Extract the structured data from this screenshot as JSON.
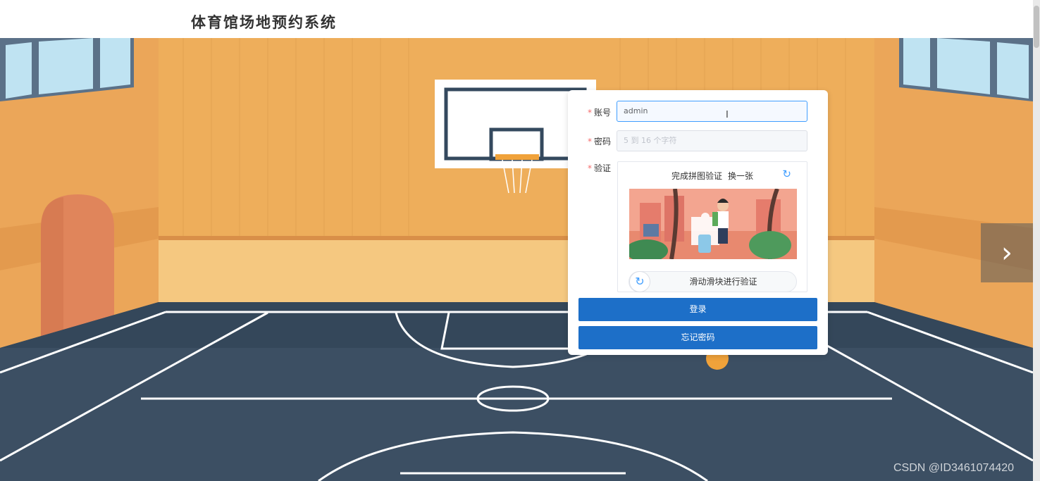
{
  "header": {
    "title": "体育馆场地预约系统"
  },
  "login": {
    "account_label": "账号",
    "account_value": "admin",
    "password_label": "密码",
    "password_placeholder": "5 到 16 个字符",
    "verify_label": "验证",
    "required_mark": "*",
    "captcha_title": "完成拼图验证",
    "captcha_switch": "换一张",
    "refresh_icon": "↻",
    "slider_icon": "↻",
    "slider_text": "滑动滑块进行验证",
    "login_button": "登录",
    "forgot_button": "忘记密码"
  },
  "carousel": {
    "next_icon": "›"
  },
  "watermark": "CSDN @ID3461074420",
  "colors": {
    "primary": "#1d6fc8",
    "required": "#f56c6c",
    "accent": "#409eff"
  }
}
